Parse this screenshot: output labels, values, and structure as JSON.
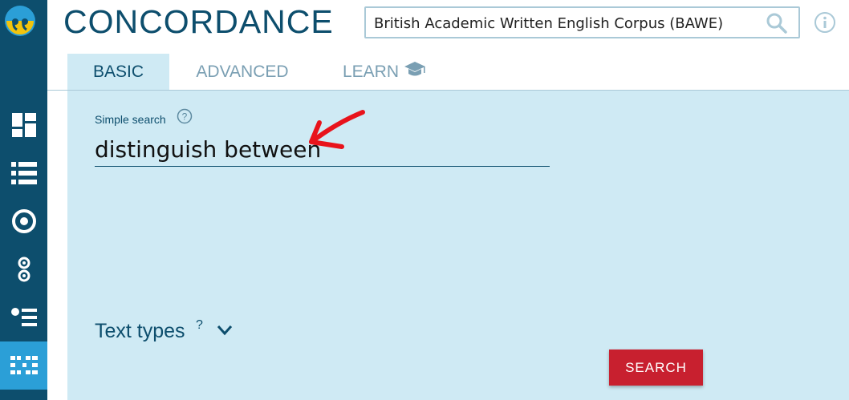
{
  "app": {
    "title": "CONCORDANCE"
  },
  "corpus": {
    "selected": "British Academic Written English Corpus (BAWE)"
  },
  "tabs": [
    {
      "label": "BASIC",
      "active": true
    },
    {
      "label": "ADVANCED",
      "active": false
    },
    {
      "label": "LEARN",
      "active": false,
      "icon": "graduation-cap-icon"
    }
  ],
  "basic": {
    "simple_search_label": "Simple search",
    "simple_search_value": "distinguish between",
    "text_types_label": "Text types",
    "text_types_help": "?",
    "search_button": "SEARCH"
  },
  "sidebar": {
    "items": [
      {
        "icon": "dashboard-icon"
      },
      {
        "icon": "list-icon"
      },
      {
        "icon": "target-icon"
      },
      {
        "icon": "collocations-icon"
      },
      {
        "icon": "bulleted-list-icon"
      },
      {
        "icon": "concordance-icon",
        "active": true
      }
    ]
  },
  "colors": {
    "sidebar": "#0d4e6d",
    "sidebar_active": "#2b9fd7",
    "panel": "#cfeaf4",
    "accent": "#0d4e6d",
    "button": "#c8202f",
    "annotation_arrow": "#e8131b"
  }
}
